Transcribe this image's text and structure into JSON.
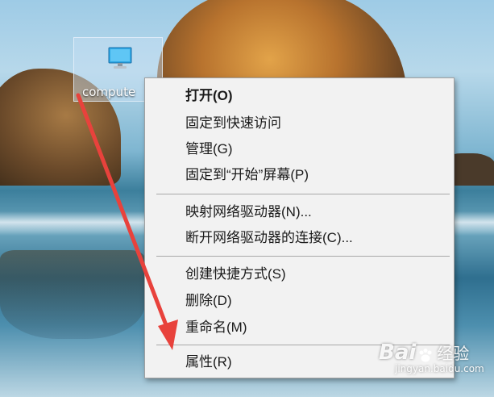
{
  "desktop": {
    "icon": {
      "name": "this-pc-icon",
      "label": "compute"
    }
  },
  "context_menu": {
    "items": [
      {
        "label": "打开(O)",
        "bold": true
      },
      {
        "label": "固定到快速访问"
      },
      {
        "label": "管理(G)"
      },
      {
        "label": "固定到“开始”屏幕(P)"
      },
      {
        "label": "映射网络驱动器(N)..."
      },
      {
        "label": "断开网络驱动器的连接(C)..."
      },
      {
        "label": "创建快捷方式(S)"
      },
      {
        "label": "删除(D)"
      },
      {
        "label": "重命名(M)"
      },
      {
        "label": "属性(R)"
      }
    ]
  },
  "annotation": {
    "arrow_color": "#e8423c"
  },
  "watermark": {
    "logo_a": "Bai",
    "logo_b": "经验",
    "url": "jingyan.baidu.com"
  },
  "colors": {
    "menu_bg": "#f2f2f2",
    "menu_border": "#a0a0a0",
    "separator": "#a8a8a8"
  }
}
